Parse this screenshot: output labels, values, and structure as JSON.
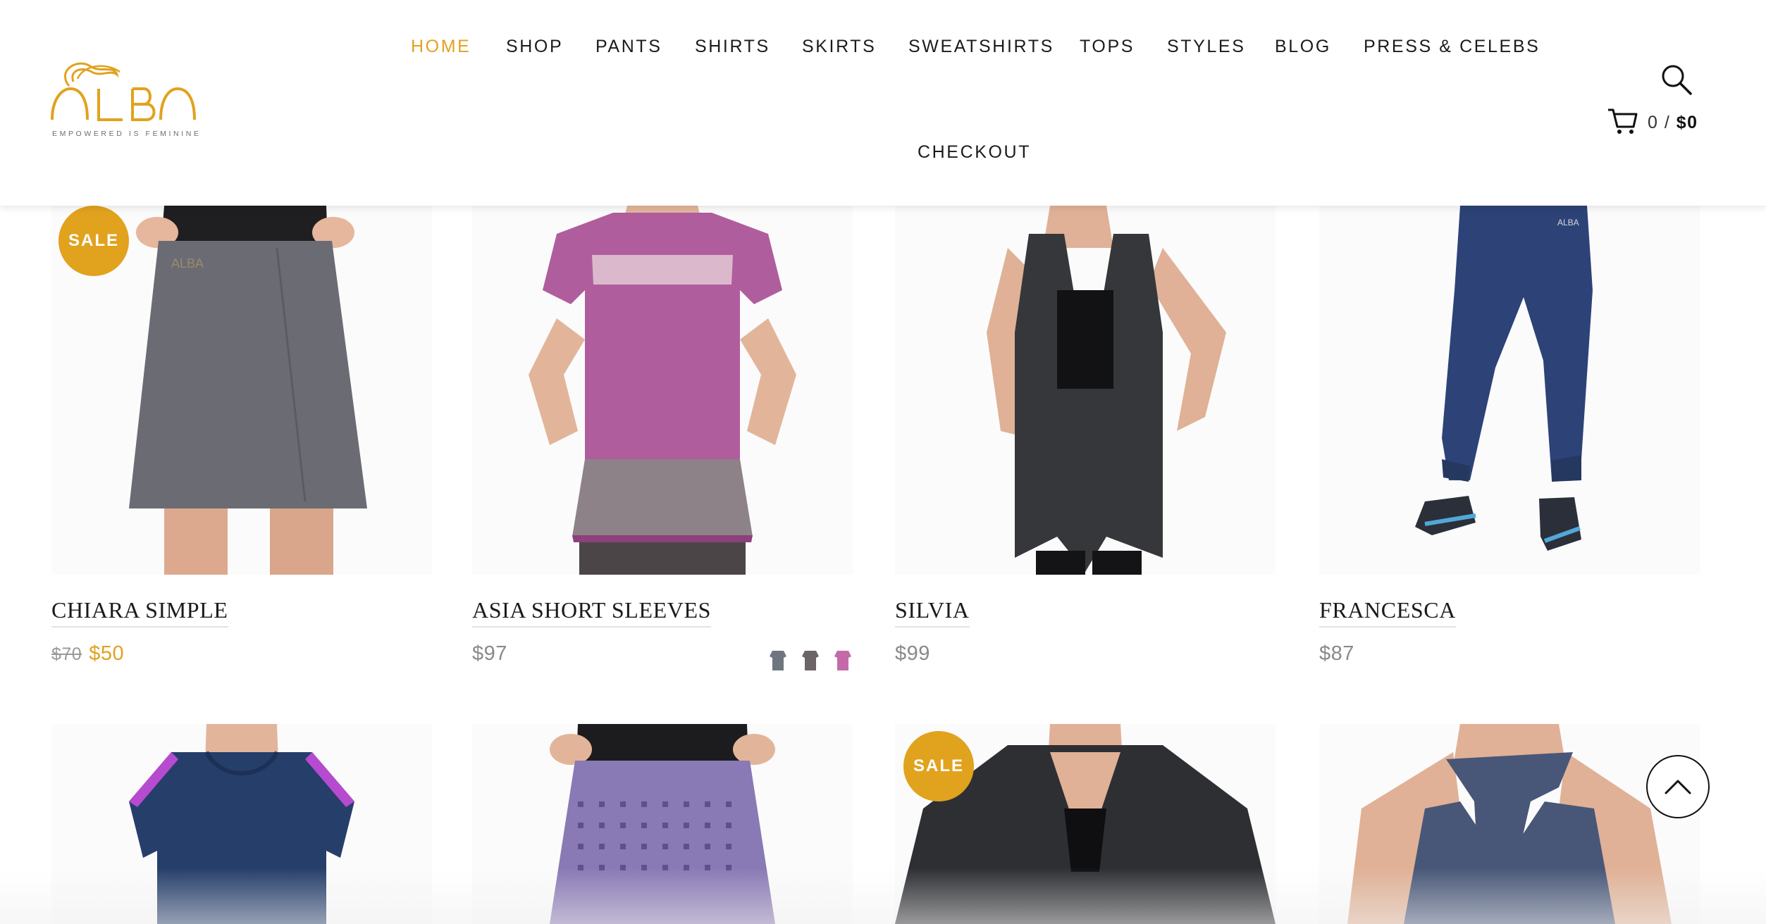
{
  "brand": {
    "name": "ALBA",
    "tagline": "EMPOWERED IS FEMININE",
    "accent_color": "#e1a21e"
  },
  "nav": {
    "items": [
      {
        "label": "HOME",
        "active": true
      },
      {
        "label": "SHOP"
      },
      {
        "label": "PANTS"
      },
      {
        "label": "SHIRTS"
      },
      {
        "label": "SKIRTS"
      },
      {
        "label": "SWEATSHIRTS"
      },
      {
        "label": "TOPS"
      },
      {
        "label": "STYLES"
      },
      {
        "label": "BLOG"
      },
      {
        "label": "PRESS & CELEBS"
      },
      {
        "label": "CHECKOUT"
      }
    ]
  },
  "header_icons": {
    "search": "search-icon",
    "cart": "cart-icon"
  },
  "cart": {
    "count": "0 /",
    "total": "$0"
  },
  "sale_badge_label": "SALE",
  "products": [
    {
      "name": "CHIARA SIMPLE",
      "old_price": "$70",
      "price": "$50",
      "on_sale": true,
      "garment_color": "#6b6b73"
    },
    {
      "name": "ASIA SHORT SLEEVES",
      "price": "$97",
      "on_sale": false,
      "garment_color": "#b05d9e",
      "swatch_colors": [
        "#6f7680",
        "#6c6466",
        "#c46aa9"
      ]
    },
    {
      "name": "SILVIA",
      "price": "$99",
      "on_sale": false,
      "garment_color": "#35373b"
    },
    {
      "name": "FRANCESCA",
      "price": "$87",
      "on_sale": false,
      "garment_color": "#2d4277"
    },
    {
      "on_sale": false,
      "garment_color": "#263e6a"
    },
    {
      "on_sale": false,
      "garment_color": "#8979b4"
    },
    {
      "on_sale": true,
      "garment_color": "#2e2f33"
    },
    {
      "on_sale": false,
      "garment_color": "#485778"
    }
  ],
  "back_to_top_icon": "chevron-up-icon"
}
